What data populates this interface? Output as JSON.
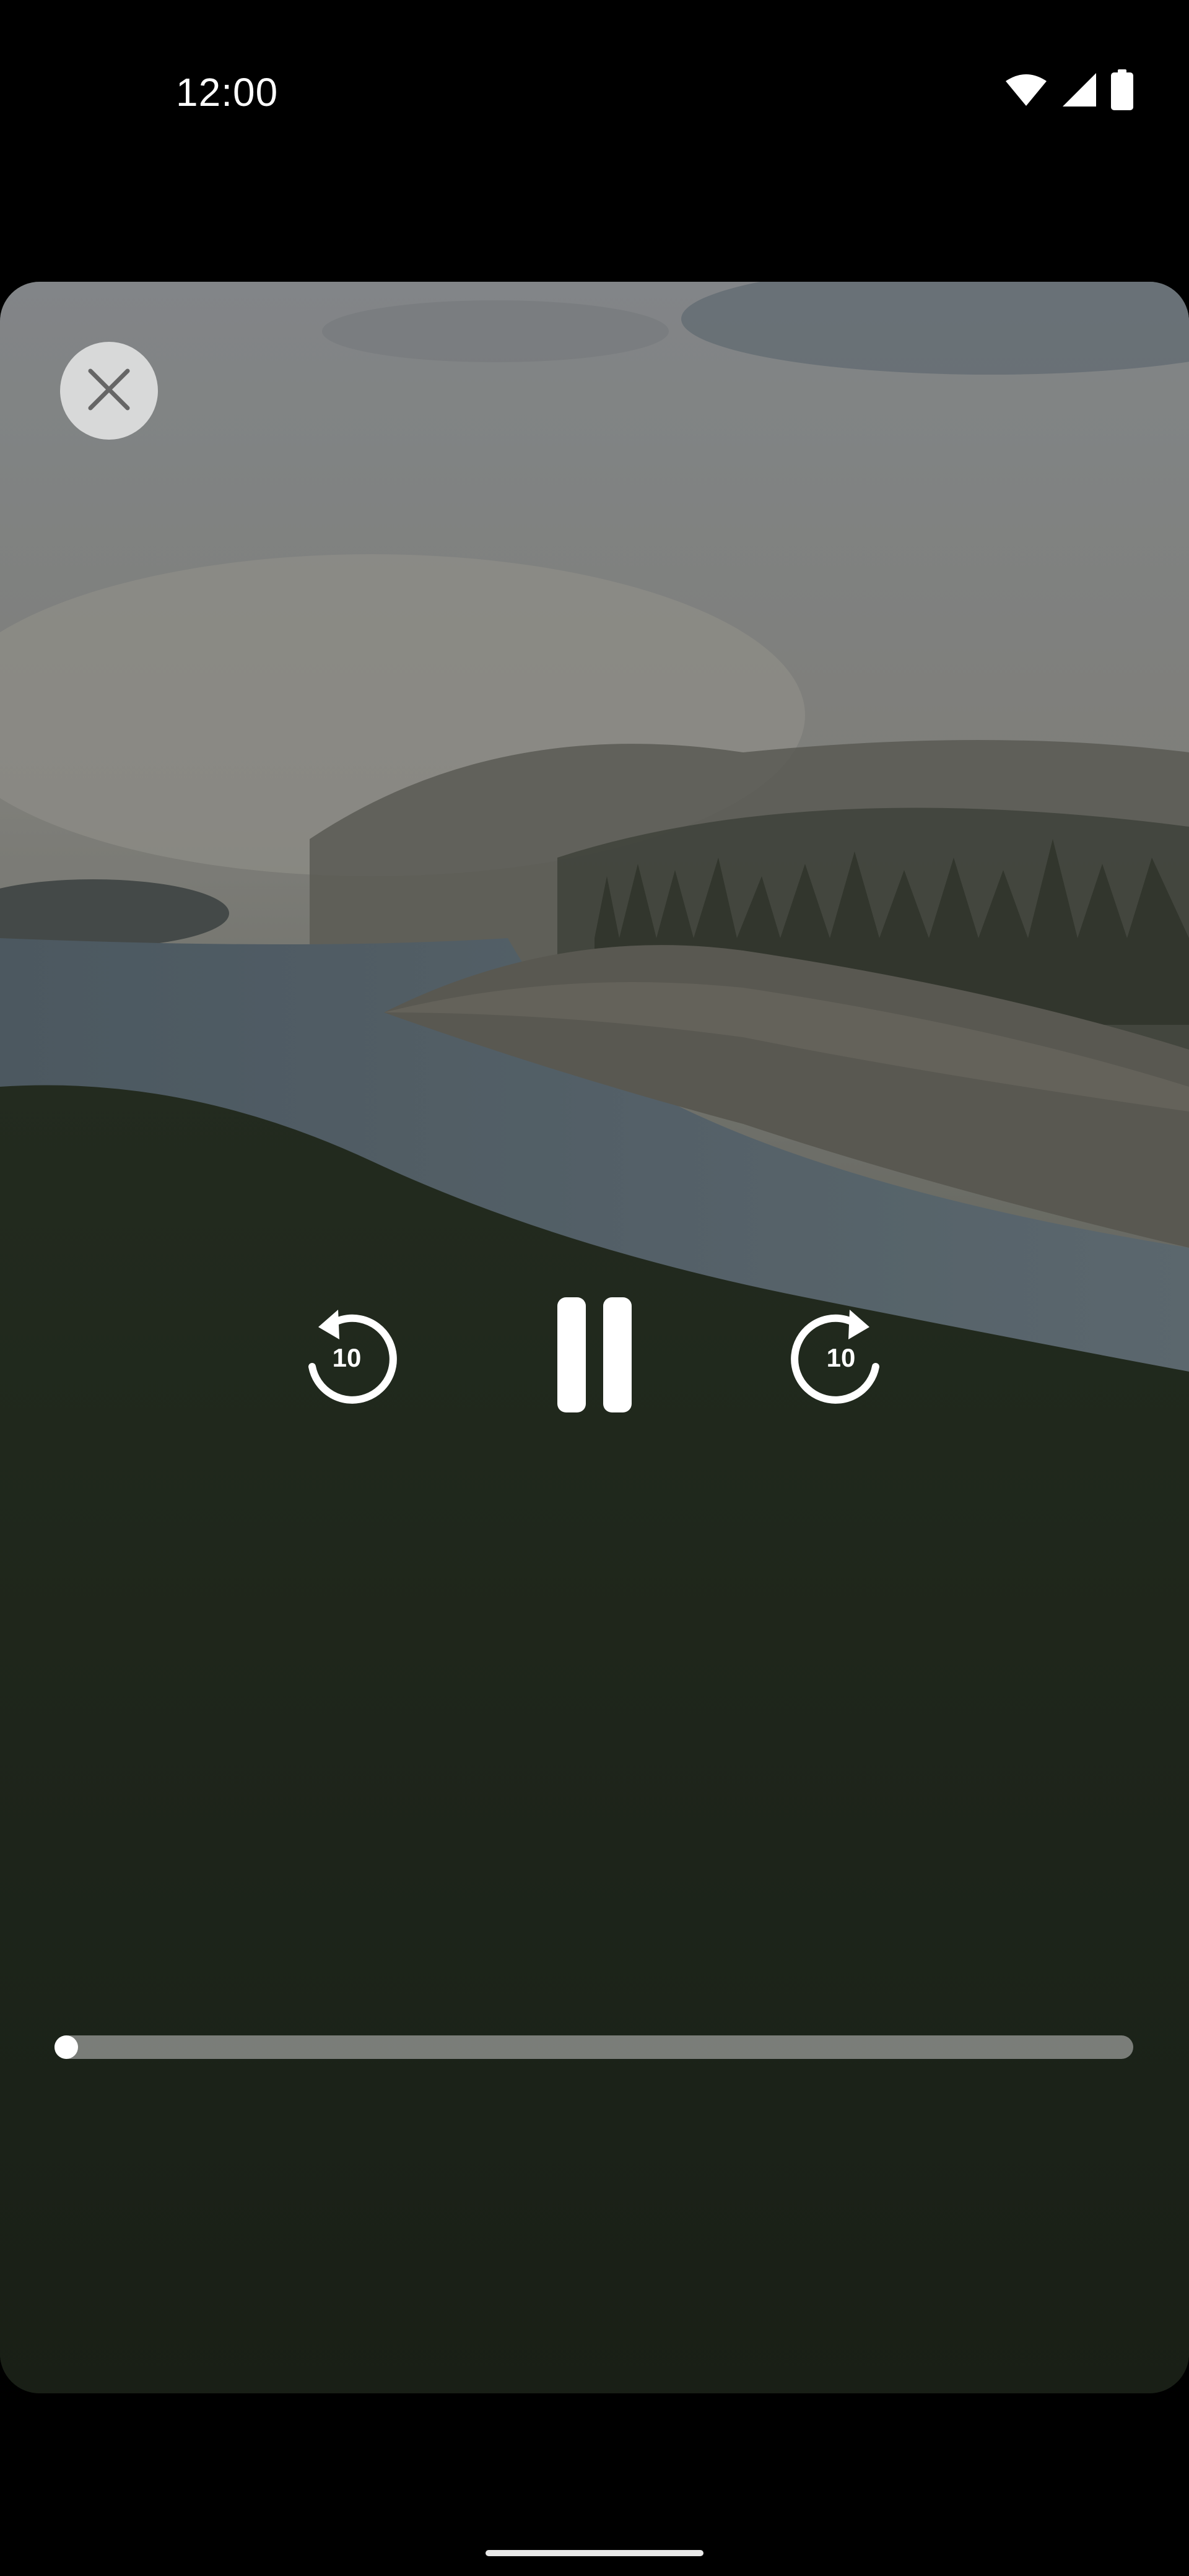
{
  "status_bar": {
    "time": "12:00",
    "icons": [
      "wifi-icon",
      "cellular-signal-icon",
      "battery-icon"
    ]
  },
  "player": {
    "close_icon": "close-icon",
    "rewind": {
      "icon": "replay-10-icon",
      "label": "10"
    },
    "play_state_icon": "pause-icon",
    "forward": {
      "icon": "forward-10-icon",
      "label": "10"
    },
    "progress_fraction": 0.02
  },
  "colors": {
    "background": "#000000",
    "controls": "#ffffff",
    "progress_track": "#a8a8a8",
    "close_button_bg": "#ebebeb"
  }
}
